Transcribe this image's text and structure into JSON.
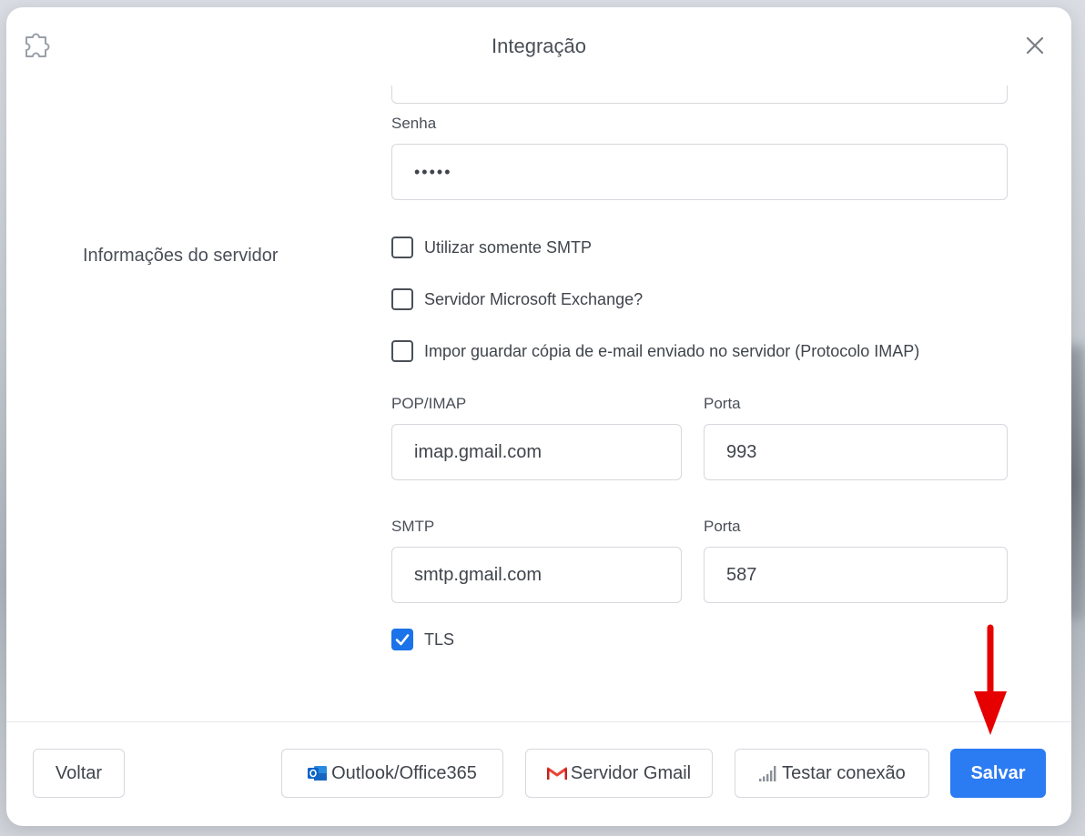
{
  "dialog": {
    "title": "Integração"
  },
  "account": {
    "password_label": "Senha",
    "password_value": "•••••"
  },
  "server": {
    "section_label": "Informações do servidor",
    "checkboxes": [
      {
        "label": "Utilizar somente SMTP",
        "checked": false
      },
      {
        "label": "Servidor Microsoft Exchange?",
        "checked": false
      },
      {
        "label": "Impor guardar cópia de e-mail enviado no servidor (Protocolo IMAP)",
        "checked": false
      }
    ],
    "incoming_label": "POP/IMAP",
    "incoming_value": "imap.gmail.com",
    "incoming_port_label": "Porta",
    "incoming_port_value": "993",
    "smtp_label": "SMTP",
    "smtp_value": "smtp.gmail.com",
    "smtp_port_label": "Porta",
    "smtp_port_value": "587",
    "tls": {
      "label": "TLS",
      "checked": true
    }
  },
  "footer": {
    "back_label": "Voltar",
    "outlook_label": "Outlook/Office365",
    "gmail_label": "Servidor Gmail",
    "test_label": "Testar conexão",
    "save_label": "Salvar"
  },
  "colors": {
    "primary": "#2b7bf3",
    "annotation_arrow": "#e60000",
    "gmail_red": "#ea4335",
    "outlook_blue": "#0a64c8"
  },
  "icons": {
    "header_left": "puzzle-icon",
    "header_right": "close-icon",
    "outlook": "outlook-icon",
    "gmail": "gmail-icon",
    "test": "signal-bars-icon"
  }
}
